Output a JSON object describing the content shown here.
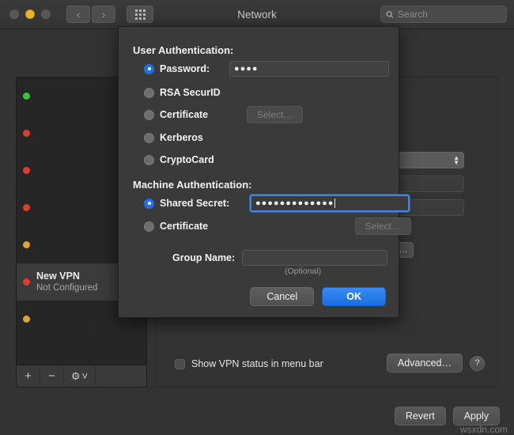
{
  "window": {
    "title": "Network",
    "traffic_lights": [
      {
        "name": "close",
        "color": "#575757",
        "active": false
      },
      {
        "name": "minimize",
        "color": "#f0b429",
        "active": true
      },
      {
        "name": "maximize",
        "color": "#575757",
        "active": false
      }
    ],
    "nav_back": "‹",
    "nav_forward": "›",
    "grid_icon": "grid-icon",
    "search": {
      "placeholder": "Search",
      "value": "",
      "icon": "search-icon"
    }
  },
  "sidebar": {
    "items": [
      {
        "name": "",
        "status": "",
        "dot": "green",
        "redacted": true,
        "selected": false
      },
      {
        "name": "",
        "status": "",
        "dot": "red",
        "redacted": true,
        "selected": false
      },
      {
        "name": "",
        "status": "",
        "dot": "red",
        "redacted": true,
        "selected": false
      },
      {
        "name": "",
        "status": "",
        "dot": "red",
        "redacted": true,
        "selected": false
      },
      {
        "name": "",
        "status": "",
        "dot": "amber",
        "redacted": true,
        "selected": false
      },
      {
        "name": "New VPN",
        "status": "Not Configured",
        "dot": "red",
        "redacted": false,
        "selected": true
      },
      {
        "name": "",
        "status": "",
        "dot": "amber",
        "redacted": true,
        "selected": false
      }
    ],
    "toolbar": {
      "add": "+",
      "remove": "−",
      "actions": "⚙",
      "actions_chevron": "˅"
    }
  },
  "main": {
    "show_vpn_status_label": "Show VPN status in menu bar",
    "show_vpn_status_checked": false,
    "advanced_label": "Advanced…",
    "help_label": "?",
    "revert_label": "Revert",
    "apply_label": "Apply",
    "watermark": "wsxdn.com"
  },
  "dialog": {
    "user_auth_title": "User Authentication:",
    "user_auth_options": [
      {
        "label": "Password:",
        "selected": true,
        "has_field": true,
        "has_button": false
      },
      {
        "label": "RSA SecurID",
        "selected": false,
        "has_field": false,
        "has_button": false
      },
      {
        "label": "Certificate",
        "selected": false,
        "has_field": false,
        "has_button": true
      },
      {
        "label": "Kerberos",
        "selected": false,
        "has_field": false,
        "has_button": false
      },
      {
        "label": "CryptoCard",
        "selected": false,
        "has_field": false,
        "has_button": false
      }
    ],
    "password_value": "●●●●",
    "user_cert_select_label": "Select…",
    "machine_auth_title": "Machine Authentication:",
    "machine_auth_options": [
      {
        "label": "Shared Secret:",
        "selected": true,
        "has_field": true,
        "has_button": false
      },
      {
        "label": "Certificate",
        "selected": false,
        "has_field": false,
        "has_button": true
      }
    ],
    "shared_secret_value": "●●●●●●●●●●●●●",
    "machine_cert_select_label": "Select…",
    "group_name_label": "Group Name:",
    "group_name_value": "",
    "group_name_hint": "(Optional)",
    "cancel_label": "Cancel",
    "ok_label": "OK",
    "accent_color": "#1f6fea",
    "focus_color": "#3d87e0"
  }
}
